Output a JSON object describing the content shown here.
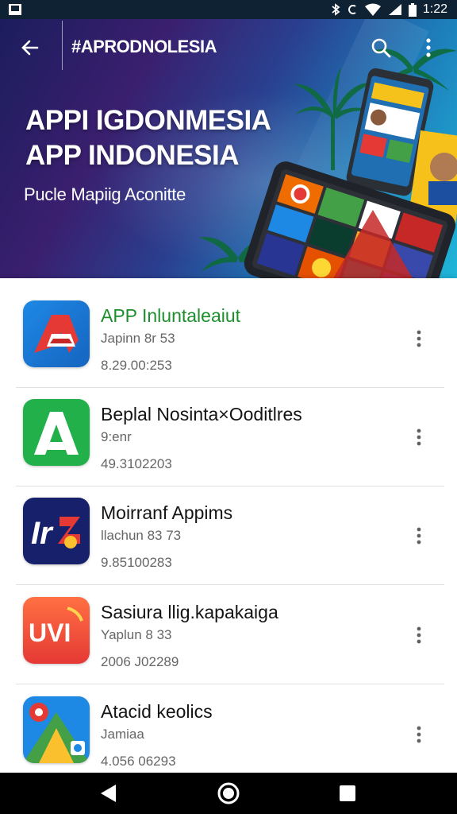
{
  "status_bar": {
    "time": "1:22"
  },
  "header": {
    "toolbar_title": "#APRODNOLESIA",
    "hero_title_line1": "APPI IGDONMESIA",
    "hero_title_line2": "APP INDONESIA",
    "hero_subtitle": "Pucle Mapiig Aconitte"
  },
  "apps": [
    {
      "name": "APP  Inluntaleaiut",
      "sub": "Japinn 8r 53",
      "meta": "8.29.00:253",
      "name_color": "#1e8f2e"
    },
    {
      "name": "Beplal Nosinta×Ooditlres",
      "sub": "9:enr",
      "meta": "49.3102203"
    },
    {
      "name": "Moirranf Appims",
      "sub": "llachun 83 73",
      "meta": "9.85100283"
    },
    {
      "name": "Sasiura llig.kapakaiga",
      "sub": "Yaplun 8 33",
      "meta": "2006 J02289"
    },
    {
      "name": "Atacid keolics",
      "sub": "Jamiaa",
      "meta": "4.056 06293"
    }
  ],
  "icons": {
    "app1": "red-a-logo-icon",
    "app2": "green-a-logo-icon",
    "app3": "ir-logo-icon",
    "app4": "uvi-logo-icon",
    "app5": "maps-pin-icon"
  },
  "icon_text": {
    "app3": "Ir",
    "app4": "UVI"
  },
  "colors": {
    "status_bar": "#0e2233",
    "accent_green": "#1e8f2e",
    "nav_bar": "#000000"
  }
}
